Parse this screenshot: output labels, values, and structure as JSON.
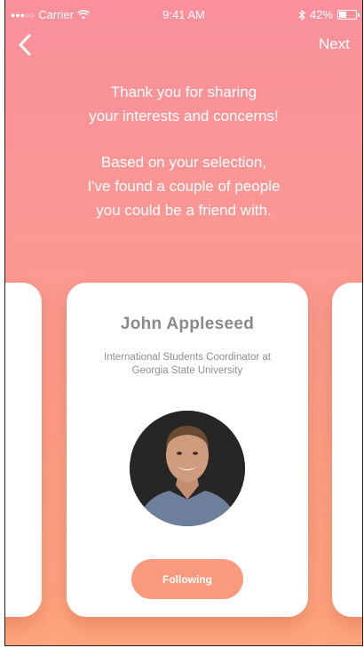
{
  "status_bar": {
    "signal": "●●●○○",
    "carrier": "Carrier",
    "time": "9:41 AM",
    "battery": "42%"
  },
  "nav": {
    "next_label": "Next"
  },
  "message": {
    "line1": "Thank you for sharing",
    "line2": "your interests and concerns!",
    "line3": "Based on your selection,",
    "line4": "I've found a couple of people",
    "line5": "you could be a friend with."
  },
  "card": {
    "name": "John Appleseed",
    "role_line1": "International Students Coordinator at",
    "role_line2": "Georgia State University",
    "button_label": "Following"
  },
  "colors": {
    "gradient_top": "#f9909c",
    "gradient_bottom": "#fda57d",
    "button": "#f99a7f",
    "card": "#ffffff"
  },
  "icons": {
    "back": "chevron-left-icon",
    "wifi": "wifi-icon",
    "bluetooth": "bluetooth-icon",
    "battery": "battery-icon"
  }
}
